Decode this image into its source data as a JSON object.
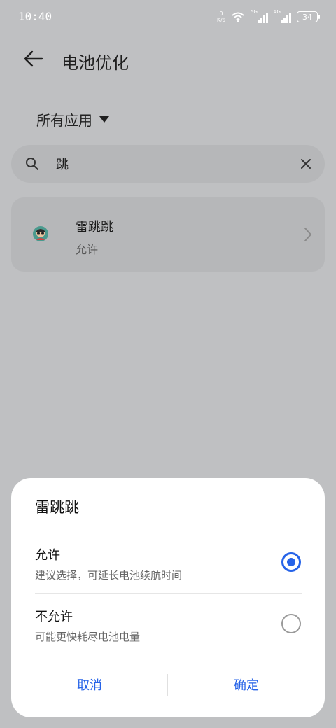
{
  "status_bar": {
    "time": "10:40",
    "net_speed_value": "0",
    "net_speed_unit": "K/s",
    "signal1_label": "5G",
    "signal2_label": "4G",
    "battery": "34",
    "wifi_icon": "wifi-icon"
  },
  "header": {
    "title": "电池优化",
    "back_icon": "arrow-left-icon"
  },
  "filter": {
    "label": "所有应用"
  },
  "search": {
    "value": "跳"
  },
  "app": {
    "name": "雷跳跳",
    "status": "允许"
  },
  "dialog": {
    "title": "雷跳跳",
    "options": [
      {
        "title": "允许",
        "desc": "建议选择，可延长电池续航时间",
        "selected": true
      },
      {
        "title": "不允许",
        "desc": "可能更快耗尽电池电量",
        "selected": false
      }
    ],
    "cancel_label": "取消",
    "ok_label": "确定",
    "accent": "#2663e8"
  }
}
